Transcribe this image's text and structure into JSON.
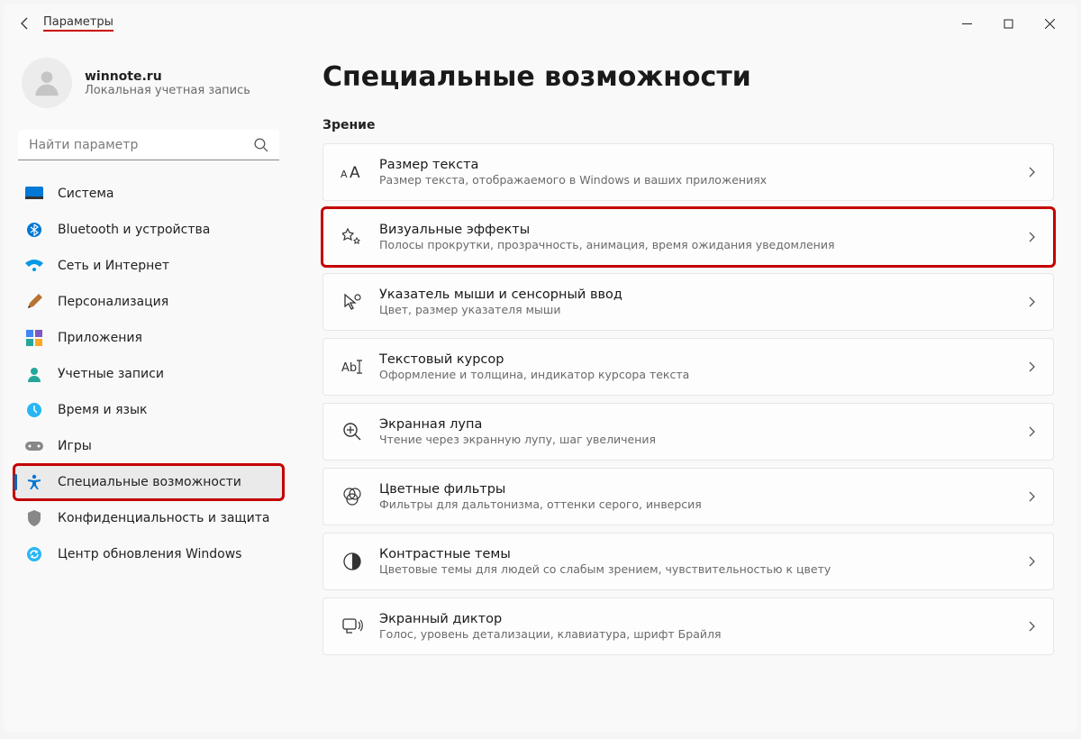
{
  "app_title": "Параметры",
  "account": {
    "name": "winnote.ru",
    "sub": "Локальная учетная запись"
  },
  "search": {
    "placeholder": "Найти параметр"
  },
  "nav": [
    {
      "label": "Система",
      "icon": "system"
    },
    {
      "label": "Bluetooth и устройства",
      "icon": "bluetooth"
    },
    {
      "label": "Сеть и Интернет",
      "icon": "wifi"
    },
    {
      "label": "Персонализация",
      "icon": "personalize"
    },
    {
      "label": "Приложения",
      "icon": "apps"
    },
    {
      "label": "Учетные записи",
      "icon": "accounts"
    },
    {
      "label": "Время и язык",
      "icon": "time"
    },
    {
      "label": "Игры",
      "icon": "games"
    },
    {
      "label": "Специальные возможности",
      "icon": "accessibility",
      "active": true,
      "highlight": true
    },
    {
      "label": "Конфиденциальность и защита",
      "icon": "privacy"
    },
    {
      "label": "Центр обновления Windows",
      "icon": "update"
    }
  ],
  "page": {
    "title": "Специальные возможности",
    "section": "Зрение",
    "items": [
      {
        "title": "Размер текста",
        "sub": "Размер текста, отображаемого в Windows и ваших приложениях",
        "icon": "textsize"
      },
      {
        "title": "Визуальные эффекты",
        "sub": "Полосы прокрутки, прозрачность, анимация, время ожидания уведомления",
        "icon": "effects",
        "highlight": true
      },
      {
        "title": "Указатель мыши и сенсорный ввод",
        "sub": "Цвет, размер указателя мыши",
        "icon": "pointer"
      },
      {
        "title": "Текстовый курсор",
        "sub": "Оформление и толщина, индикатор курсора текста",
        "icon": "textcursor"
      },
      {
        "title": "Экранная лупа",
        "sub": "Чтение через экранную лупу, шаг увеличения",
        "icon": "magnifier"
      },
      {
        "title": "Цветные фильтры",
        "sub": "Фильтры для дальтонизма, оттенки серого, инверсия",
        "icon": "colorfilter"
      },
      {
        "title": "Контрастные темы",
        "sub": "Цветовые темы для людей со слабым зрением, чувствительностью к цвету",
        "icon": "contrast"
      },
      {
        "title": "Экранный диктор",
        "sub": "Голос, уровень детализации, клавиатура, шрифт Брайля",
        "icon": "narrator"
      }
    ]
  }
}
